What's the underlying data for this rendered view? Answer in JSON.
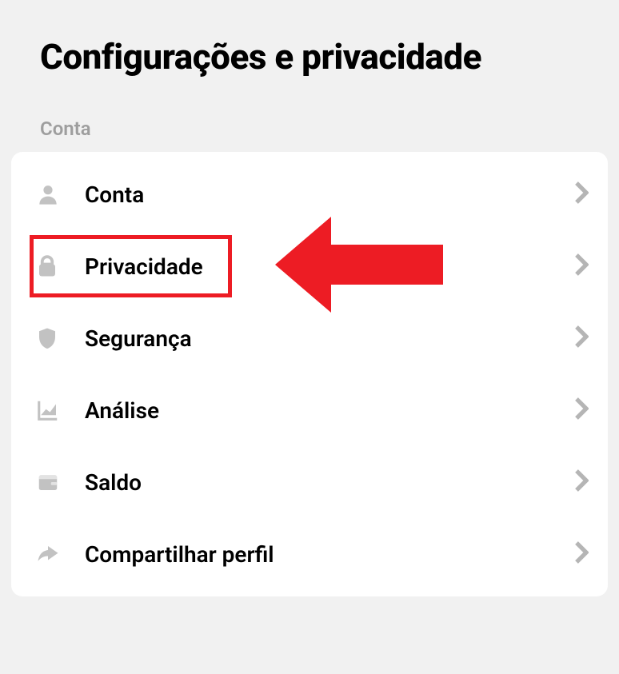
{
  "header": {
    "title": "Configurações e privacidade"
  },
  "section": {
    "label": "Conta"
  },
  "menu": {
    "items": [
      {
        "label": "Conta"
      },
      {
        "label": "Privacidade"
      },
      {
        "label": "Segurança"
      },
      {
        "label": "Análise"
      },
      {
        "label": "Saldo"
      },
      {
        "label": "Compartilhar perfil"
      }
    ]
  }
}
